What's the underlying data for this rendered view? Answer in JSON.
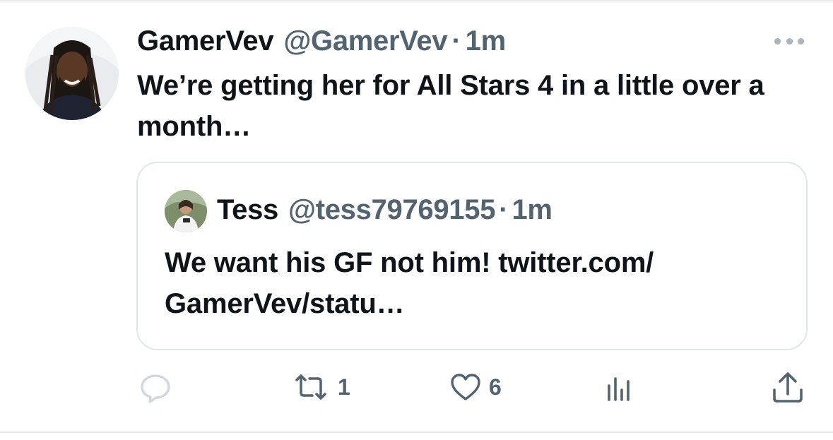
{
  "tweet": {
    "display_name": "GamerVev",
    "handle": "@GamerVev",
    "separator": "·",
    "time": "1m",
    "text": "We’re getting her for All Stars 4 in a little over a month…"
  },
  "quoted_tweet": {
    "display_name": "Tess",
    "handle": "@tess79769155",
    "separator": "·",
    "time": "1m",
    "text": "We want his GF not him! twitter.com/ GamerVev/statu…"
  },
  "actions": {
    "reply_icon": "reply-bubble-icon",
    "retweet_icon": "retweet-icon",
    "retweet_count": "1",
    "like_icon": "heart-icon",
    "like_count": "6",
    "views_icon": "views-bar-chart-icon",
    "share_icon": "share-upload-icon"
  },
  "colors": {
    "text_primary": "#0f1419",
    "text_secondary": "#536471",
    "icon_muted": "#aab4bd",
    "border": "#e1e6ea"
  }
}
